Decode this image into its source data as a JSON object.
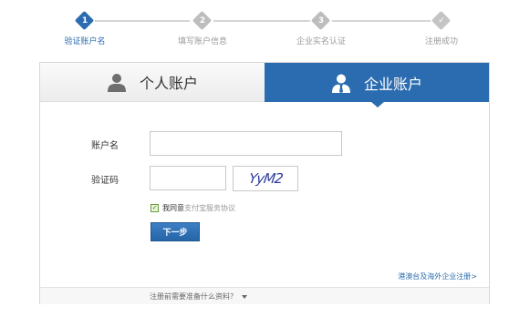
{
  "stepper": {
    "steps": [
      {
        "number": "1",
        "label": "验证账户名"
      },
      {
        "number": "2",
        "label": "填写账户信息"
      },
      {
        "number": "3",
        "label": "企业实名认证"
      },
      {
        "number": "✓",
        "label": "注册成功"
      }
    ],
    "active_index": 0
  },
  "tabs": {
    "personal": {
      "label": "个人账户",
      "icon": "person-icon"
    },
    "enterprise": {
      "label": "企业账户",
      "icon": "business-person-icon"
    },
    "selected": "enterprise"
  },
  "form": {
    "account_label": "账户名",
    "account_value": "",
    "captcha_label": "验证码",
    "captcha_value": "",
    "captcha_image_text": "YyM2",
    "agree_prefix": "我同意",
    "agreement_link": "支付宝服务协议",
    "agree_checked": true,
    "next_button": "下一步"
  },
  "links": {
    "overseas": "港澳台及海外企业注册>",
    "prep": "注册前需要准备什么资料？"
  },
  "colors": {
    "accent": "#2b6cb0",
    "step_inactive": "#bdbdbd"
  }
}
